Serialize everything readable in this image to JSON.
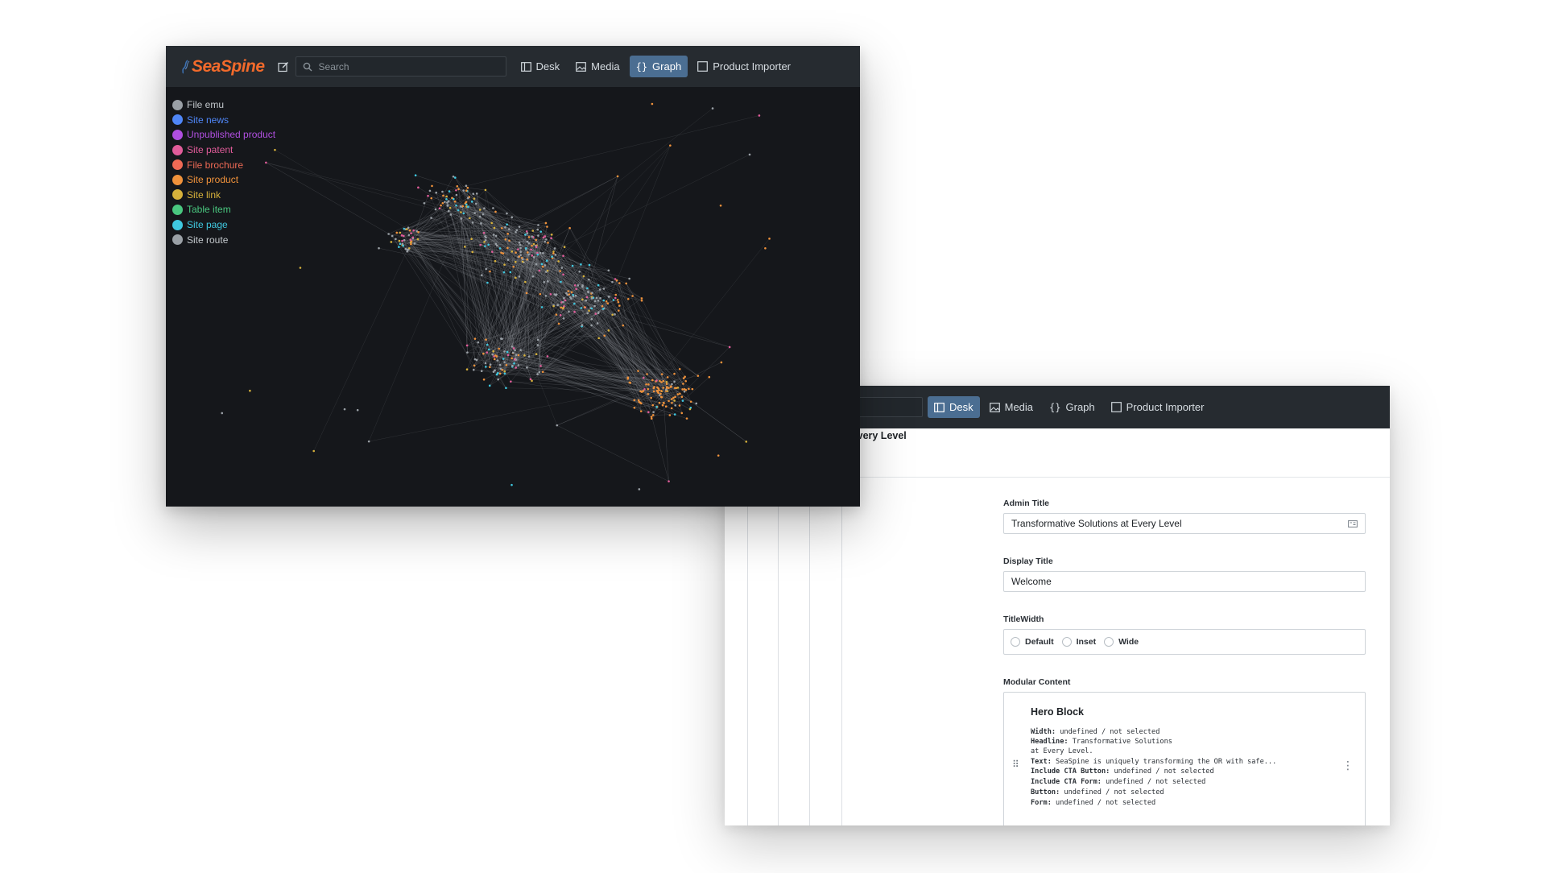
{
  "brand": {
    "name": "SeaSpine"
  },
  "nav": {
    "search_placeholder": "Search",
    "items": [
      {
        "label": "Desk",
        "icon": "desk-icon"
      },
      {
        "label": "Media",
        "icon": "image-icon"
      },
      {
        "label": "Graph",
        "icon": "braces-icon"
      },
      {
        "label": "Product Importer",
        "icon": "checkbox-icon"
      }
    ]
  },
  "front_window": {
    "active_tab": "Graph",
    "legend": [
      {
        "label": "File emu",
        "color": "#9aa0a6"
      },
      {
        "label": "Site news",
        "color": "#4f86f7"
      },
      {
        "label": "Unpublished product",
        "color": "#b04fe0"
      },
      {
        "label": "Site patent",
        "color": "#e15c9a"
      },
      {
        "label": "File brochure",
        "color": "#ef6a55"
      },
      {
        "label": "Site product",
        "color": "#f0923b"
      },
      {
        "label": "Site link",
        "color": "#d6b13b"
      },
      {
        "label": "Table item",
        "color": "#49c77f"
      },
      {
        "label": "Site page",
        "color": "#3fc8e0"
      },
      {
        "label": "Site route",
        "color": "#9aa0a6"
      }
    ]
  },
  "back_window": {
    "active_tab": "Desk",
    "document_title": "ansformative Solutions at Every Level",
    "fields": {
      "admin_title": {
        "label": "Admin Title",
        "value": "Transformative Solutions at Every Level"
      },
      "display_title": {
        "label": "Display Title",
        "value": "Welcome"
      },
      "title_width": {
        "label": "TitleWidth",
        "options": [
          "Default",
          "Inset",
          "Wide"
        ]
      },
      "modular_content": {
        "label": "Modular Content",
        "block_title": "Hero Block",
        "lines": [
          {
            "key": "Width:",
            "value": " undefined / not selected"
          },
          {
            "key": "Headline:",
            "value": " Transformative Solutions"
          },
          {
            "key": "",
            "value": "at Every Level."
          },
          {
            "key": "Text:",
            "value": " SeaSpine is uniquely transforming the OR with safe..."
          },
          {
            "key": "Include CTA Button:",
            "value": " undefined / not selected"
          },
          {
            "key": "Include CTA Form:",
            "value": " undefined / not selected"
          },
          {
            "key": "Button:",
            "value": " undefined / not selected"
          },
          {
            "key": "Form:",
            "value": " undefined / not selected"
          }
        ]
      }
    }
  },
  "colors": {
    "accent": "#4b6e92",
    "brand": "#f26a2b",
    "topbar": "#262b30",
    "graph_bg": "#15171b"
  }
}
